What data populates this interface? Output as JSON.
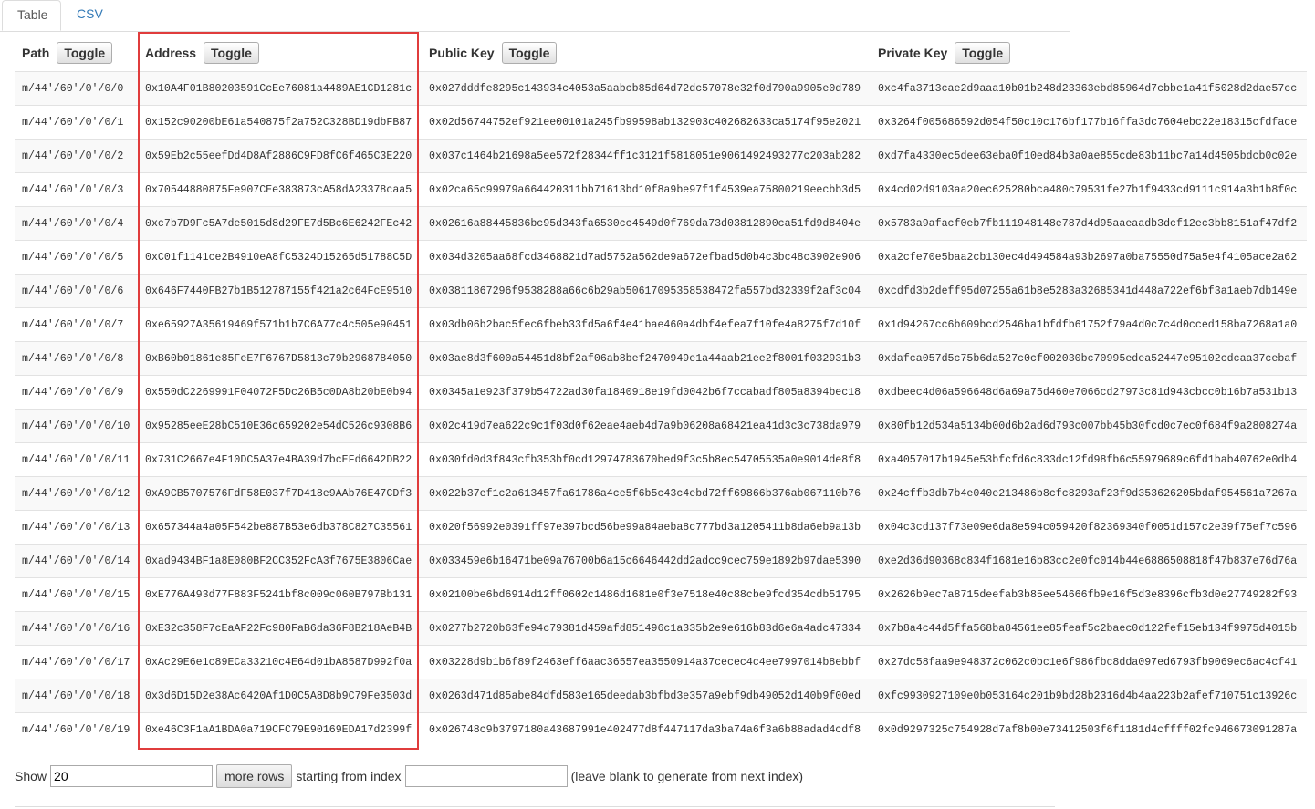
{
  "tabs": [
    "Table",
    "CSV"
  ],
  "headers": {
    "path": "Path",
    "address": "Address",
    "public_key": "Public Key",
    "private_key": "Private Key",
    "toggle": "Toggle"
  },
  "rows": [
    [
      "m/44'/60'/0'/0/0",
      "0x10A4F01B80203591CcEe76081a4489AE1CD1281c",
      "0x027dddfe8295c143934c4053a5aabcb85d64d72dc57078e32f0d790a9905e0d789",
      "0xc4fa3713cae2d9aaa10b01b248d23363ebd85964d7cbbe1a41f5028d2dae57cc"
    ],
    [
      "m/44'/60'/0'/0/1",
      "0x152c90200bE61a540875f2a752C328BD19dbFB87",
      "0x02d56744752ef921ee00101a245fb99598ab132903c402682633ca5174f95e2021",
      "0x3264f005686592d054f50c10c176bf177b16ffa3dc7604ebc22e18315cfdface"
    ],
    [
      "m/44'/60'/0'/0/2",
      "0x59Eb2c55eefDd4D8Af2886C9FD8fC6f465C3E220",
      "0x037c1464b21698a5ee572f28344ff1c3121f5818051e9061492493277c203ab282",
      "0xd7fa4330ec5dee63eba0f10ed84b3a0ae855cde83b11bc7a14d4505bdcb0c02e"
    ],
    [
      "m/44'/60'/0'/0/3",
      "0x70544880875Fe907CEe383873cA58dA23378caa5",
      "0x02ca65c99979a664420311bb71613bd10f8a9be97f1f4539ea75800219eecbb3d5",
      "0x4cd02d9103aa20ec625280bca480c79531fe27b1f9433cd9111c914a3b1b8f0c"
    ],
    [
      "m/44'/60'/0'/0/4",
      "0xc7b7D9Fc5A7de5015d8d29FE7d5Bc6E6242FEc42",
      "0x02616a88445836bc95d343fa6530cc4549d0f769da73d03812890ca51fd9d8404e",
      "0x5783a9afacf0eb7fb111948148e787d4d95aaeaadb3dcf12ec3bb8151af47df2"
    ],
    [
      "m/44'/60'/0'/0/5",
      "0xC01f1141ce2B4910eA8fC5324D15265d51788C5D",
      "0x034d3205aa68fcd3468821d7ad5752a562de9a672efbad5d0b4c3bc48c3902e906",
      "0xa2cfe70e5baa2cb130ec4d494584a93b2697a0ba75550d75a5e4f4105ace2a62"
    ],
    [
      "m/44'/60'/0'/0/6",
      "0x646F7440FB27b1B512787155f421a2c64FcE9510",
      "0x03811867296f9538288a66c6b29ab50617095358538472fa557bd32339f2af3c04",
      "0xcdfd3b2deff95d07255a61b8e5283a32685341d448a722ef6bf3a1aeb7db149e"
    ],
    [
      "m/44'/60'/0'/0/7",
      "0xe65927A35619469f571b1b7C6A77c4c505e90451",
      "0x03db06b2bac5fec6fbeb33fd5a6f4e41bae460a4dbf4efea7f10fe4a8275f7d10f",
      "0x1d94267cc6b609bcd2546ba1bfdfb61752f79a4d0c7c4d0cced158ba7268a1a0"
    ],
    [
      "m/44'/60'/0'/0/8",
      "0xB60b01861e85FeE7F6767D5813c79b2968784050",
      "0x03ae8d3f600a54451d8bf2af06ab8bef2470949e1a44aab21ee2f8001f032931b3",
      "0xdafca057d5c75b6da527c0cf002030bc70995edea52447e95102cdcaa37cebaf"
    ],
    [
      "m/44'/60'/0'/0/9",
      "0x550dC2269991F04072F5Dc26B5c0DA8b20bE0b94",
      "0x0345a1e923f379b54722ad30fa1840918e19fd0042b6f7ccabadf805a8394bec18",
      "0xdbeec4d06a596648d6a69a75d460e7066cd27973c81d943cbcc0b16b7a531b13"
    ],
    [
      "m/44'/60'/0'/0/10",
      "0x95285eeE28bC510E36c659202e54dC526c9308B6",
      "0x02c419d7ea622c9c1f03d0f62eae4aeb4d7a9b06208a68421ea41d3c3c738da979",
      "0x80fb12d534a5134b00d6b2ad6d793c007bb45b30fcd0c7ec0f684f9a2808274a"
    ],
    [
      "m/44'/60'/0'/0/11",
      "0x731C2667e4F10DC5A37e4BA39d7bcEFd6642DB22",
      "0x030fd0d3f843cfb353bf0cd12974783670bed9f3c5b8ec54705535a0e9014de8f8",
      "0xa4057017b1945e53bfcfd6c833dc12fd98fb6c55979689c6fd1bab40762e0db4"
    ],
    [
      "m/44'/60'/0'/0/12",
      "0xA9CB5707576FdF58E037f7D418e9AAb76E47CDf3",
      "0x022b37ef1c2a613457fa61786a4ce5f6b5c43c4ebd72ff69866b376ab067110b76",
      "0x24cffb3db7b4e040e213486b8cfc8293af23f9d353626205bdaf954561a7267a"
    ],
    [
      "m/44'/60'/0'/0/13",
      "0x657344a4a05F542be887B53e6db378C827C35561",
      "0x020f56992e0391ff97e397bcd56be99a84aeba8c777bd3a1205411b8da6eb9a13b",
      "0x04c3cd137f73e09e6da8e594c059420f82369340f0051d157c2e39f75ef7c596"
    ],
    [
      "m/44'/60'/0'/0/14",
      "0xad9434BF1a8E080BF2CC352FcA3f7675E3806Cae",
      "0x033459e6b16471be09a76700b6a15c6646442dd2adcc9cec759e1892b97dae5390",
      "0xe2d36d90368c834f1681e16b83cc2e0fc014b44e6886508818f47b837e76d76a"
    ],
    [
      "m/44'/60'/0'/0/15",
      "0xE776A493d77F883F5241bf8c009c060B797Bb131",
      "0x02100be6bd6914d12ff0602c1486d1681e0f3e7518e40c88cbe9fcd354cdb51795",
      "0x2626b9ec7a8715deefab3b85ee54666fb9e16f5d3e8396cfb3d0e27749282f93"
    ],
    [
      "m/44'/60'/0'/0/16",
      "0xE32c358F7cEaAF22Fc980FaB6da36F8B218AeB4B",
      "0x0277b2720b63fe94c79381d459afd851496c1a335b2e9e616b83d6e6a4adc47334",
      "0x7b8a4c44d5ffa568ba84561ee85feaf5c2baec0d122fef15eb134f9975d4015b"
    ],
    [
      "m/44'/60'/0'/0/17",
      "0xAc29E6e1c89ECa33210c4E64d01bA8587D992f0a",
      "0x03228d9b1b6f89f2463eff6aac36557ea3550914a37cecec4c4ee7997014b8ebbf",
      "0x27dc58faa9e948372c062c0bc1e6f986fbc8dda097ed6793fb9069ec6ac4cf41"
    ],
    [
      "m/44'/60'/0'/0/18",
      "0x3d6D15D2e38Ac6420Af1D0C5A8D8b9C79Fe3503d",
      "0x0263d471d85abe84dfd583e165deedab3bfbd3e357a9ebf9db49052d140b9f00ed",
      "0xfc9930927109e0b053164c201b9bd28b2316d4b4aa223b2afef710751c13926c"
    ],
    [
      "m/44'/60'/0'/0/19",
      "0xe46C3F1aA1BDA0a719CFC79E90169EDA17d2399f",
      "0x026748c9b3797180a43687991e402477d8f447117da3ba74a6f3a6b88adad4cdf8",
      "0x0d9297325c754928d7af8b00e73412503f6f1181d4cffff02fc946673091287a"
    ]
  ],
  "footer": {
    "show_label": "Show",
    "show_value": "20",
    "more_rows_label": "more rows",
    "starting_label": "starting from index",
    "index_value": "",
    "hint": "(leave blank to generate from next index)"
  },
  "colors": {
    "highlight": "#e03c3c",
    "link": "#337ab7"
  }
}
